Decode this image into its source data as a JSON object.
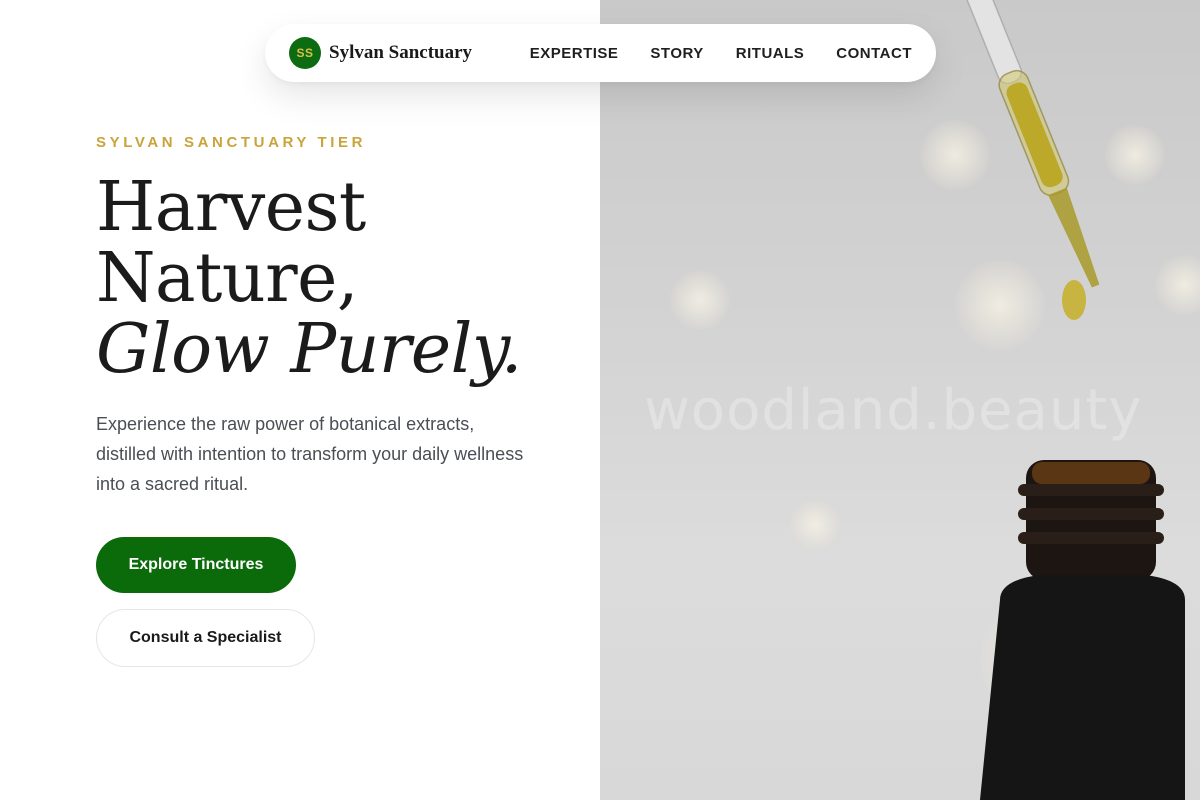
{
  "nav": {
    "logo_initials": "SS",
    "brand": "Sylvan Sanctuary",
    "links": [
      "EXPERTISE",
      "STORY",
      "RITUALS",
      "CONTACT"
    ]
  },
  "hero": {
    "eyebrow": "SYLVAN SANCTUARY TIER",
    "headline_lines": [
      "Harvest",
      "Nature,",
      "Glow Purely."
    ],
    "lead": "Experience the raw power of botanical extracts, distilled with intention to transform your daily wellness into a sacred ritual.",
    "primary_cta": "Explore Tinctures",
    "secondary_cta": "Consult a Specialist"
  },
  "image": {
    "watermark": "woodland.beauty"
  },
  "colors": {
    "brand_green": "#0b6b0b",
    "accent_gold": "#c9a43a"
  }
}
